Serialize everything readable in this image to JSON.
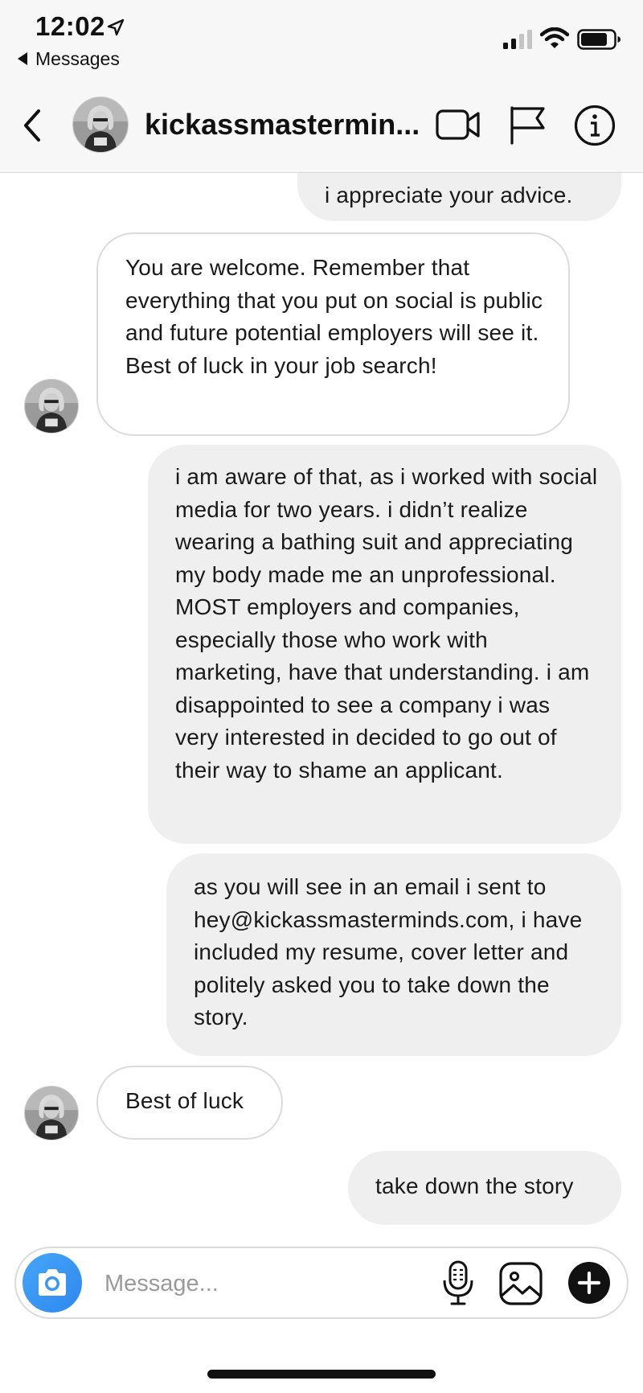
{
  "status_bar": {
    "time": "12:02",
    "back_app_label": "Messages",
    "icons": [
      "location-arrow-icon",
      "cellular-signal-icon",
      "wifi-icon",
      "battery-icon"
    ]
  },
  "header": {
    "title": "kickassmastermin...",
    "icons": [
      "back-chevron-icon",
      "video-call-icon",
      "flag-icon",
      "info-icon"
    ]
  },
  "conversation": {
    "messages": [
      {
        "sender": "me",
        "text": "i appreciate your advice."
      },
      {
        "sender": "them",
        "text": "You are welcome. Remember that everything that you put on social is public and future potential employers will see it. Best of luck in your job search!"
      },
      {
        "sender": "me",
        "text": "i am aware of that, as i worked with social media for two years. i didn’t realize wearing a bathing suit and appreciating my body made me an unprofessional. MOST employers and companies, especially those who work with marketing, have that understanding. i am disappointed to see a company i was very interested in decided to go out of their way to shame an applicant."
      },
      {
        "sender": "me",
        "text": "as you will see in an email i sent to hey@kickassmasterminds.com, i have included my resume, cover letter and politely asked you to take down the story."
      },
      {
        "sender": "them",
        "text": "Best of luck"
      },
      {
        "sender": "me",
        "text": "take down the story"
      }
    ]
  },
  "composer": {
    "placeholder": "Message...",
    "value": "",
    "icons": [
      "camera-icon",
      "microphone-icon",
      "gallery-icon",
      "add-icon"
    ],
    "camera_color": "#3897f0"
  }
}
